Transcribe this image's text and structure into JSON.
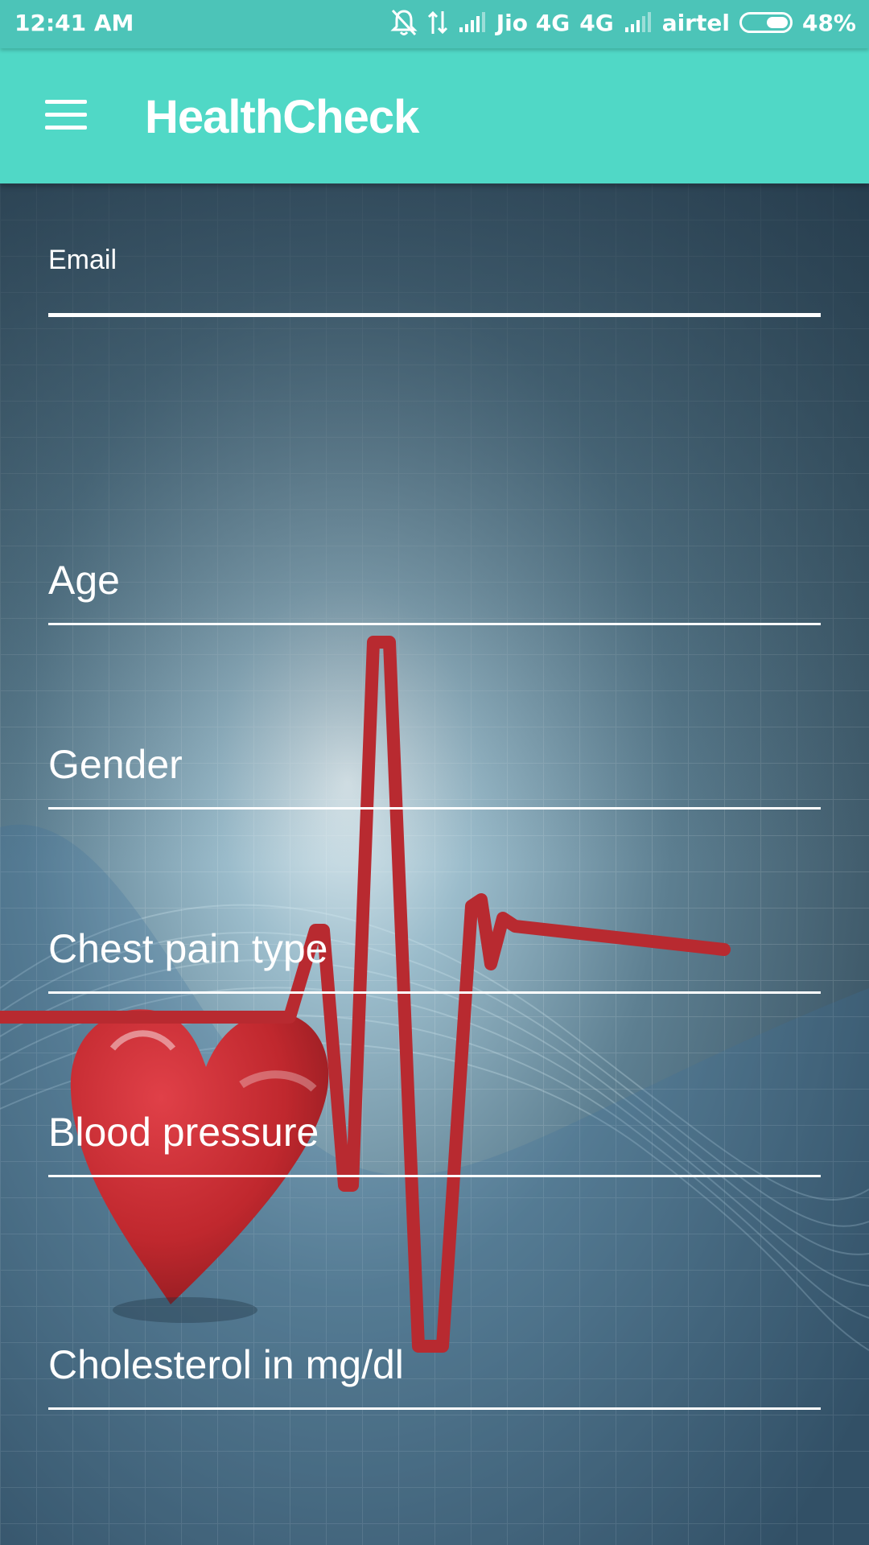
{
  "status_bar": {
    "time": "12:41 AM",
    "carrier1": "Jio 4G",
    "network": "4G",
    "carrier2": "airtel",
    "battery": "48%",
    "battery_level": 0.48,
    "icons": [
      "mute-bell-icon",
      "data-transfer-icon",
      "signal-icon",
      "signal-icon",
      "battery-icon"
    ]
  },
  "app_bar": {
    "title": "HealthCheck",
    "menu_icon": "hamburger-menu-icon",
    "color": "#50d8c6"
  },
  "form": {
    "email_label": "Email",
    "email_value": "",
    "fields": [
      "Age",
      "Gender",
      "Chest pain type",
      "Blood pressure",
      "Cholesterol in mg/dl"
    ]
  },
  "background": {
    "image": "heart-with-ecg-line",
    "heart_color": "#c0282e",
    "ecg_color": "#b82a30"
  }
}
